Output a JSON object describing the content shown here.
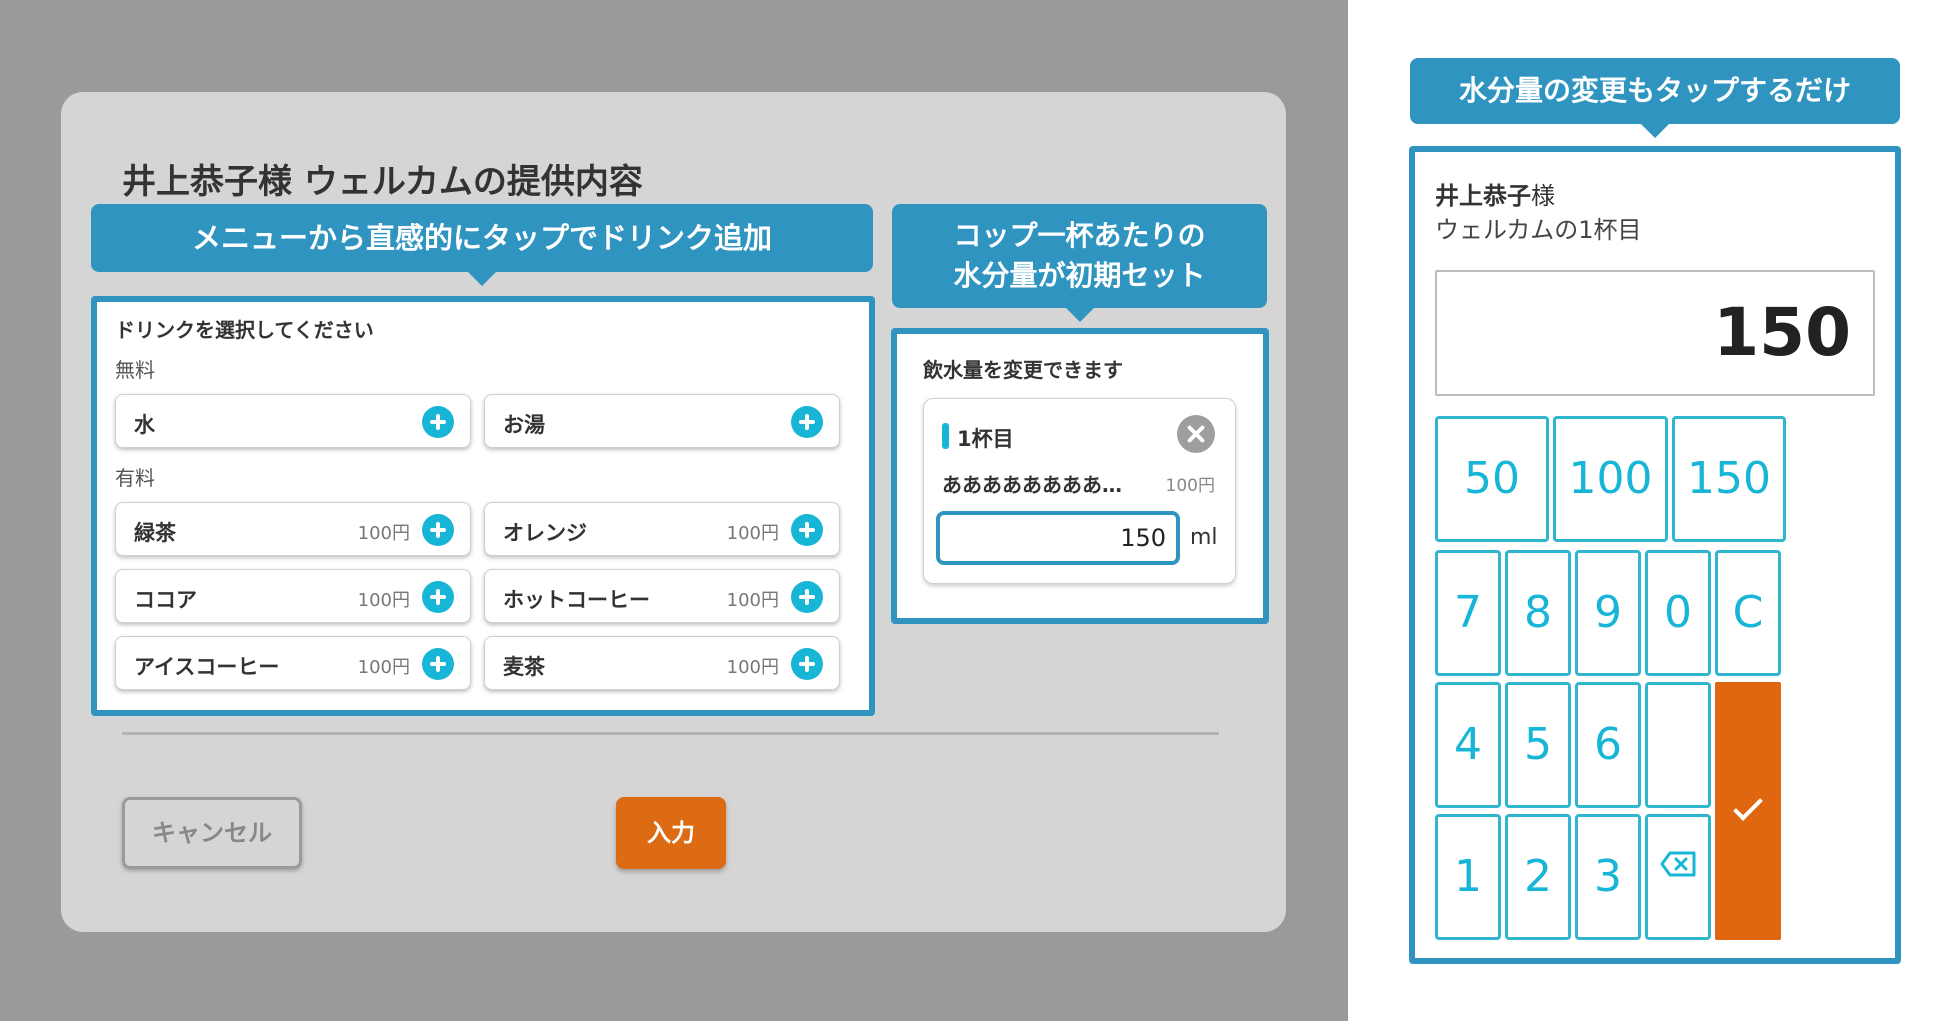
{
  "modal": {
    "title": "井上恭子様 ウェルカムの提供内容",
    "callout_drink": "メニューから直感的にタップでドリンク追加",
    "callout_water_line1": "コップ一杯あたりの",
    "callout_water_line2": "水分量が初期セット",
    "drink_panel": {
      "heading": "ドリンクを選択してください",
      "free_label": "無料",
      "paid_label": "有料",
      "free_items": [
        {
          "name": "水"
        },
        {
          "name": "お湯"
        }
      ],
      "paid_items": [
        {
          "name": "緑茶",
          "price": "100円"
        },
        {
          "name": "オレンジ",
          "price": "100円"
        },
        {
          "name": "ココア",
          "price": "100円"
        },
        {
          "name": "ホットコーヒー",
          "price": "100円"
        },
        {
          "name": "アイスコーヒー",
          "price": "100円"
        },
        {
          "name": "麦茶",
          "price": "100円"
        }
      ]
    },
    "water_panel": {
      "heading": "飲水量を変更できます",
      "cup_title": "1杯目",
      "drink_name": "ああああああああ…",
      "price": "100円",
      "amount": "150",
      "unit": "ml"
    },
    "cancel_label": "キャンセル",
    "submit_label": "入力"
  },
  "keypad": {
    "callout": "水分量の変更もタップするだけ",
    "name": "井上恭子",
    "honorific": "様",
    "subtitle": "ウェルカムの1杯目",
    "display_value": "150",
    "presets": [
      "50",
      "100",
      "150"
    ],
    "rows": [
      [
        "7",
        "8",
        "9",
        "0",
        "C"
      ],
      [
        "4",
        "5",
        "6"
      ],
      [
        "1",
        "2",
        "3"
      ]
    ]
  },
  "colors": {
    "accent": "#2f95c0",
    "plus": "#17b6d6",
    "submit": "#dc6b13",
    "enter": "#e0660f"
  }
}
